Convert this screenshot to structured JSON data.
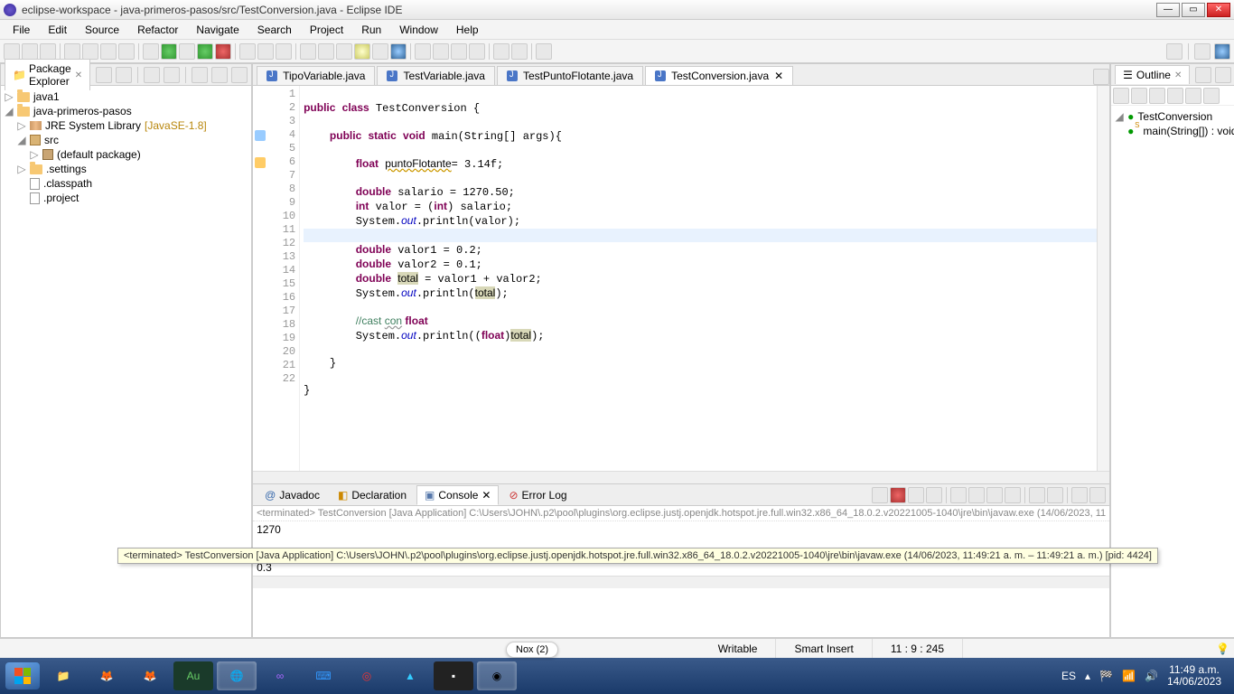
{
  "window": {
    "title": "eclipse-workspace - java-primeros-pasos/src/TestConversion.java - Eclipse IDE"
  },
  "menu": [
    "File",
    "Edit",
    "Source",
    "Refactor",
    "Navigate",
    "Search",
    "Project",
    "Run",
    "Window",
    "Help"
  ],
  "package_explorer": {
    "title": "Package Explorer",
    "items": {
      "p0": "java1",
      "p1": "java-primeros-pasos",
      "p2": "JRE System Library",
      "p2_suffix": "[JavaSE-1.8]",
      "p3": "src",
      "p4": "(default package)",
      "p5": ".settings",
      "p6": ".classpath",
      "p7": ".project"
    }
  },
  "editor_tabs": [
    "TipoVariable.java",
    "TestVariable.java",
    "TestPuntoFlotante.java",
    "TestConversion.java"
  ],
  "code_lines": [
    "",
    "public class TestConversion {",
    "",
    "    public static void main(String[] args){",
    "",
    "        float puntoFlotante= 3.14f;",
    "",
    "        double salario = 1270.50;",
    "        int valor = (int) salario;",
    "        System.out.println(valor);",
    "",
    "        double valor1 = 0.2;",
    "        double valor2 = 0.1;",
    "        double total = valor1 + valor2;",
    "        System.out.println(total);",
    "",
    "        //cast con float",
    "        System.out.println((float)total);",
    "",
    "    }",
    "",
    "}"
  ],
  "outline": {
    "title": "Outline",
    "cls": "TestConversion",
    "method": "main(String[]) : void"
  },
  "bottom_tabs": {
    "javadoc": "Javadoc",
    "decl": "Declaration",
    "console": "Console",
    "errlog": "Error Log"
  },
  "console": {
    "header": "<terminated> TestConversion [Java Application] C:\\Users\\JOHN\\.p2\\pool\\plugins\\org.eclipse.justj.openjdk.hotspot.jre.full.win32.x86_64_18.0.2.v20221005-1040\\jre\\bin\\javaw.exe (14/06/2023, 11",
    "out1": "1270",
    "out2": "0.3"
  },
  "tooltip": "<terminated> TestConversion [Java Application] C:\\Users\\JOHN\\.p2\\pool\\plugins\\org.eclipse.justj.openjdk.hotspot.jre.full.win32.x86_64_18.0.2.v20221005-1040\\jre\\bin\\javaw.exe (14/06/2023, 11:49:21 a. m. – 11:49:21 a. m.) [pid: 4424]",
  "status": {
    "writable": "Writable",
    "insert": "Smart Insert",
    "pos": "11 : 9 : 245"
  },
  "nox": "Nox (2)",
  "tray": {
    "lang": "ES",
    "time": "11:49 a.m.",
    "date": "14/06/2023"
  }
}
